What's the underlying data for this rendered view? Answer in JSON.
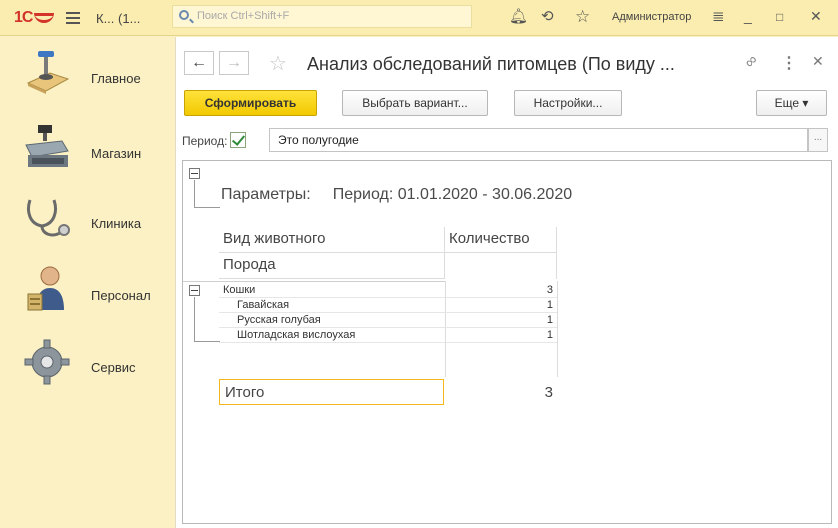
{
  "topbar": {
    "logo_text": "1С",
    "app_title": "К... (1...",
    "search_placeholder": "Поиск Ctrl+Shift+F",
    "user": "Администратор",
    "icons": [
      "bell-icon",
      "history-icon",
      "star-icon",
      "menu-icon",
      "minimize-icon",
      "maximize-icon",
      "close-icon"
    ]
  },
  "sidebar": {
    "items": [
      {
        "label": "Главное",
        "icon": "main-icon"
      },
      {
        "label": "Магазин",
        "icon": "cash-register-icon"
      },
      {
        "label": "Клиника",
        "icon": "stethoscope-icon"
      },
      {
        "label": "Персонал",
        "icon": "staff-icon"
      },
      {
        "label": "Сервис",
        "icon": "gear-icon"
      }
    ]
  },
  "form": {
    "title": "Анализ обследований питомцев (По виду ...",
    "buttons": {
      "generate": "Сформировать",
      "choose_variant": "Выбрать вариант...",
      "settings": "Настройки...",
      "more": "Еще ▾"
    },
    "period_label": "Период:",
    "period_checked": true,
    "period_value": "Это полугодие",
    "period_select": "..."
  },
  "report": {
    "params_label": "Параметры:",
    "params_value": "Период: 01.01.2020 - 30.06.2020",
    "headers": {
      "animal_type": "Вид животного",
      "count": "Количество",
      "breed": "Порода"
    },
    "group": {
      "label": "Кошки",
      "count": "3"
    },
    "rows": [
      {
        "label": "Гавайская",
        "count": "1"
      },
      {
        "label": "Русская голубая",
        "count": "1"
      },
      {
        "label": "Шотладская вислоухая",
        "count": "1"
      }
    ],
    "total": {
      "label": "Итого",
      "count": "3"
    }
  }
}
